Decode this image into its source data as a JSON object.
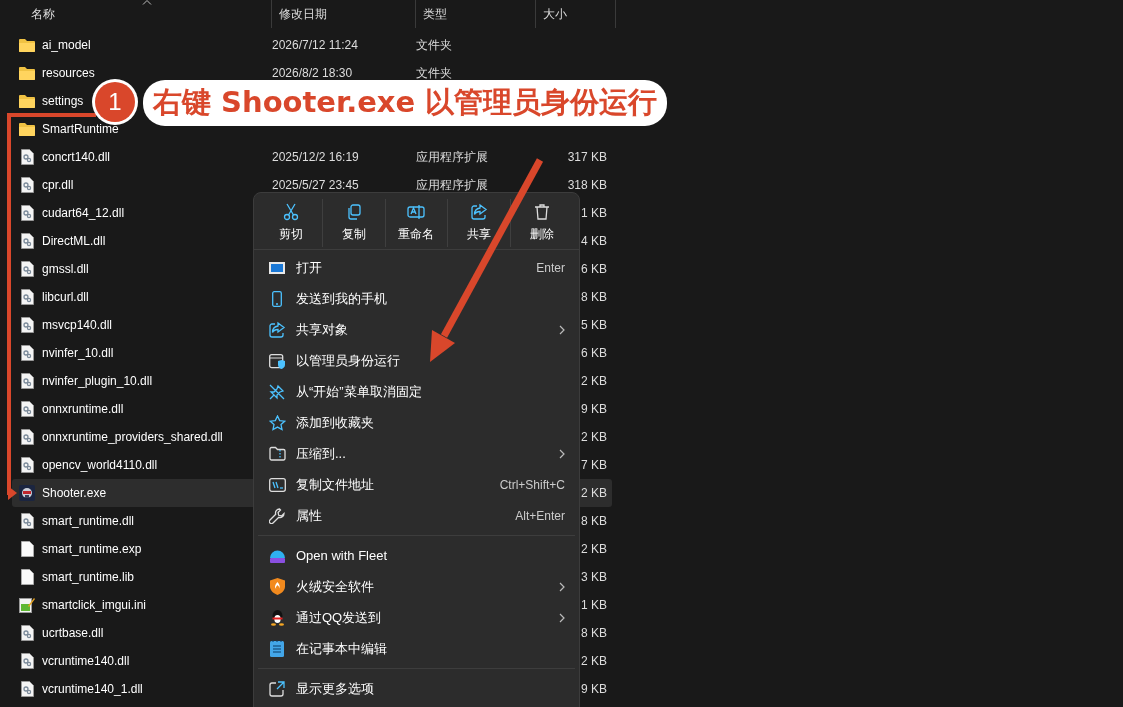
{
  "columns": [
    {
      "label": "名称",
      "sorted": true
    },
    {
      "label": "修改日期",
      "sorted": false
    },
    {
      "label": "类型",
      "sorted": false
    },
    {
      "label": "大小",
      "sorted": false
    }
  ],
  "files": [
    {
      "kind": "folder",
      "name": "ai_model",
      "date": "2026/7/12 11:24",
      "type": "文件夹",
      "selected": false
    },
    {
      "kind": "folder",
      "name": "resources",
      "date": "2026/8/2 18:30",
      "type": "文件夹",
      "selected": false
    },
    {
      "kind": "folder",
      "name": "settings",
      "selected": false
    },
    {
      "kind": "folder",
      "name": "SmartRuntime",
      "selected": false
    },
    {
      "kind": "dll",
      "name": "concrt140.dll",
      "date": "2025/12/2 16:19",
      "type": "应用程序扩展",
      "size": "317 KB",
      "selected": false
    },
    {
      "kind": "dll",
      "name": "cpr.dll",
      "date": "2025/5/27 23:45",
      "type": "应用程序扩展",
      "size": "318 KB",
      "selected": false
    },
    {
      "kind": "dll",
      "name": "cudart64_12.dll",
      "size": "1 KB",
      "selected": false
    },
    {
      "kind": "dll",
      "name": "DirectML.dll",
      "size": "4 KB",
      "selected": false
    },
    {
      "kind": "dll",
      "name": "gmssl.dll",
      "size": "6 KB",
      "selected": false
    },
    {
      "kind": "dll",
      "name": "libcurl.dll",
      "size": "8 KB",
      "selected": false
    },
    {
      "kind": "dll",
      "name": "msvcp140.dll",
      "size": "5 KB",
      "selected": false
    },
    {
      "kind": "dll",
      "name": "nvinfer_10.dll",
      "size": "6 KB",
      "selected": false
    },
    {
      "kind": "dll",
      "name": "nvinfer_plugin_10.dll",
      "size": "2 KB",
      "selected": false
    },
    {
      "kind": "dll",
      "name": "onnxruntime.dll",
      "size": "9 KB",
      "selected": false
    },
    {
      "kind": "dll",
      "name": "onnxruntime_providers_shared.dll",
      "size": "2 KB",
      "selected": false
    },
    {
      "kind": "dll",
      "name": "opencv_world4110.dll",
      "size": "7 KB",
      "selected": false
    },
    {
      "kind": "exe",
      "name": "Shooter.exe",
      "size": "2 KB",
      "selected": true
    },
    {
      "kind": "dll",
      "name": "smart_runtime.dll",
      "size": "8 KB",
      "selected": false
    },
    {
      "kind": "file",
      "name": "smart_runtime.exp",
      "size": "2 KB",
      "selected": false
    },
    {
      "kind": "file",
      "name": "smart_runtime.lib",
      "size": "3 KB",
      "selected": false
    },
    {
      "kind": "ini",
      "name": "smartclick_imgui.ini",
      "size": "1 KB",
      "selected": false
    },
    {
      "kind": "dll",
      "name": "ucrtbase.dll",
      "size": "8 KB",
      "selected": false
    },
    {
      "kind": "dll",
      "name": "vcruntime140.dll",
      "size": "2 KB",
      "selected": false
    },
    {
      "kind": "dll",
      "name": "vcruntime140_1.dll",
      "size": "9 KB",
      "selected": false
    }
  ],
  "context_menu": {
    "toolbar": [
      {
        "kind": "cut",
        "label": "剪切"
      },
      {
        "kind": "copy",
        "label": "复制"
      },
      {
        "kind": "rename",
        "label": "重命名"
      },
      {
        "kind": "share",
        "label": "共享"
      },
      {
        "kind": "delete",
        "label": "删除"
      }
    ],
    "sections": [
      [
        {
          "kind": "open",
          "label": "打开",
          "shortcut": "Enter",
          "submenu": false
        },
        {
          "kind": "phone",
          "label": "发送到我的手机",
          "submenu": false
        },
        {
          "kind": "share",
          "label": "共享对象",
          "submenu": true
        },
        {
          "kind": "admin",
          "label": "以管理员身份运行",
          "submenu": false
        },
        {
          "kind": "unpin",
          "label": "从“开始”菜单取消固定",
          "submenu": false
        },
        {
          "kind": "star",
          "label": "添加到收藏夹",
          "submenu": false
        },
        {
          "kind": "zip",
          "label": "压缩到...",
          "submenu": true
        },
        {
          "kind": "path",
          "label": "复制文件地址",
          "shortcut": "Ctrl+Shift+C",
          "submenu": false
        },
        {
          "kind": "wrench",
          "label": "属性",
          "shortcut": "Alt+Enter",
          "submenu": false
        }
      ],
      [
        {
          "kind": "fleet",
          "label": "Open with Fleet",
          "submenu": false
        },
        {
          "kind": "shield",
          "label": "火绒安全软件",
          "submenu": true
        },
        {
          "kind": "penguin",
          "label": "通过QQ发送到",
          "submenu": true
        },
        {
          "kind": "notepad",
          "label": "在记事本中编辑",
          "submenu": false
        }
      ],
      [
        {
          "kind": "more",
          "label": "显示更多选项",
          "submenu": false
        }
      ]
    ]
  },
  "annotation": {
    "badge": "1",
    "text": "右键 Shooter.exe 以管理员身份运行"
  }
}
